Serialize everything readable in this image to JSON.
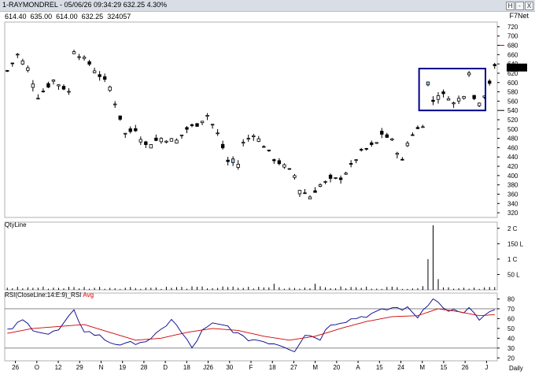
{
  "window": {
    "title": "1-RAYMONDREL - 05/06/26 09:34:29 632.25 4.30%",
    "buttons": [
      "H",
      "-",
      "X"
    ],
    "net_label": "F7Net"
  },
  "ohlc": {
    "open": "614.40",
    "high": "635.00",
    "low": "614.00",
    "close": "632.25",
    "volume": "324057"
  },
  "panels": {
    "volume_label": "QtyLine",
    "rsi_label_main": "RSI(CloseLine:14:E:9)_RSI",
    "rsi_label_avg": "Avg",
    "period_label": "Daily"
  },
  "colors": {
    "candle": "#000000",
    "highlight_box": "#00008b",
    "rsi_line": "#00008b",
    "rsi_avg": "#d00000",
    "last_price_bg": "#000000"
  },
  "chart_data": [
    {
      "type": "candlestick",
      "x_ticks": [
        "26",
        "O",
        "12",
        "29",
        "N",
        "19",
        "28",
        "D",
        "18",
        "J26",
        "30",
        "F",
        "18",
        "27",
        "M",
        "20",
        "A",
        "15",
        "24",
        "M",
        "15",
        "26",
        "J"
      ],
      "y_ticks": [
        "320",
        "340",
        "360",
        "380",
        "400",
        "420",
        "440",
        "460",
        "480",
        "500",
        "520",
        "540",
        "560",
        "580",
        "600",
        "620",
        "640",
        "660",
        "680",
        "700",
        "720"
      ],
      "ylim": [
        310,
        730
      ],
      "last_price": "632.25",
      "highlight_box": {
        "x_range": [
          "M",
          "J"
        ],
        "y_range": [
          540,
          630
        ]
      },
      "close_path": [
        [
          0,
          625
        ],
        [
          2,
          660
        ],
        [
          4,
          630
        ],
        [
          6,
          570
        ],
        [
          9,
          605
        ],
        [
          12,
          580
        ],
        [
          13,
          670
        ],
        [
          16,
          640
        ],
        [
          20,
          590
        ],
        [
          23,
          490
        ],
        [
          25,
          500
        ],
        [
          27,
          465
        ],
        [
          30,
          480
        ],
        [
          33,
          475
        ],
        [
          35,
          500
        ],
        [
          37,
          510
        ],
        [
          39,
          530
        ],
        [
          41,
          490
        ],
        [
          43,
          430
        ],
        [
          45,
          425
        ],
        [
          46,
          470
        ],
        [
          48,
          490
        ],
        [
          50,
          465
        ],
        [
          52,
          435
        ],
        [
          54,
          420
        ],
        [
          56,
          400
        ],
        [
          57,
          370
        ],
        [
          59,
          355
        ],
        [
          61,
          380
        ],
        [
          63,
          390
        ],
        [
          65,
          395
        ],
        [
          67,
          420
        ],
        [
          69,
          450
        ],
        [
          72,
          470
        ],
        [
          73,
          490
        ],
        [
          75,
          475
        ],
        [
          77,
          430
        ],
        [
          78,
          470
        ],
        [
          79,
          490
        ],
        [
          81,
          510
        ],
        [
          82,
          600
        ],
        [
          83,
          560
        ],
        [
          84,
          575
        ],
        [
          86,
          570
        ],
        [
          87,
          555
        ],
        [
          89,
          575
        ],
        [
          90,
          625
        ],
        [
          91,
          565
        ],
        [
          92,
          560
        ],
        [
          93,
          575
        ],
        [
          94,
          600
        ],
        [
          95,
          632.25
        ]
      ]
    },
    {
      "type": "bar",
      "name": "QtyLine",
      "y_ticks": [
        "50 L",
        "1 C",
        "150 L",
        "2 C"
      ],
      "ylim": [
        0,
        2.2
      ],
      "spike_x": 83,
      "spike_value": 2.1
    },
    {
      "type": "line",
      "series": [
        {
          "name": "RSI",
          "values": [
            [
              0,
              47
            ],
            [
              3,
              58
            ],
            [
              5,
              50
            ],
            [
              8,
              44
            ],
            [
              10,
              48
            ],
            [
              13,
              67
            ],
            [
              15,
              48
            ],
            [
              18,
              42
            ],
            [
              20,
              36
            ],
            [
              23,
              33
            ],
            [
              25,
              36
            ],
            [
              28,
              38
            ],
            [
              30,
              48
            ],
            [
              32,
              60
            ],
            [
              34,
              45
            ],
            [
              36,
              30
            ],
            [
              38,
              47
            ],
            [
              40,
              54
            ],
            [
              43,
              52
            ],
            [
              46,
              40
            ],
            [
              49,
              38
            ],
            [
              53,
              34
            ],
            [
              56,
              28
            ],
            [
              58,
              44
            ],
            [
              61,
              40
            ],
            [
              63,
              55
            ],
            [
              66,
              58
            ],
            [
              69,
              62
            ],
            [
              72,
              66
            ],
            [
              75,
              71
            ],
            [
              78,
              70
            ],
            [
              80,
              62
            ],
            [
              83,
              82
            ],
            [
              85,
              70
            ],
            [
              87,
              68
            ],
            [
              89,
              64
            ],
            [
              90,
              72
            ],
            [
              92,
              58
            ],
            [
              93,
              62
            ],
            [
              95,
              68
            ]
          ]
        },
        {
          "name": "Avg",
          "values": [
            [
              0,
              45
            ],
            [
              5,
              50
            ],
            [
              10,
              52
            ],
            [
              15,
              54
            ],
            [
              20,
              46
            ],
            [
              25,
              38
            ],
            [
              30,
              40
            ],
            [
              35,
              46
            ],
            [
              40,
              50
            ],
            [
              45,
              48
            ],
            [
              50,
              42
            ],
            [
              55,
              38
            ],
            [
              60,
              42
            ],
            [
              65,
              50
            ],
            [
              70,
              57
            ],
            [
              75,
              62
            ],
            [
              80,
              63
            ],
            [
              84,
              70
            ],
            [
              88,
              67
            ],
            [
              92,
              63
            ],
            [
              95,
              64
            ]
          ]
        }
      ],
      "y_ticks": [
        "20",
        "30",
        "40",
        "50",
        "60",
        "70",
        "80"
      ],
      "ylim": [
        17,
        86
      ],
      "guide_lines": [
        30,
        70
      ]
    }
  ]
}
